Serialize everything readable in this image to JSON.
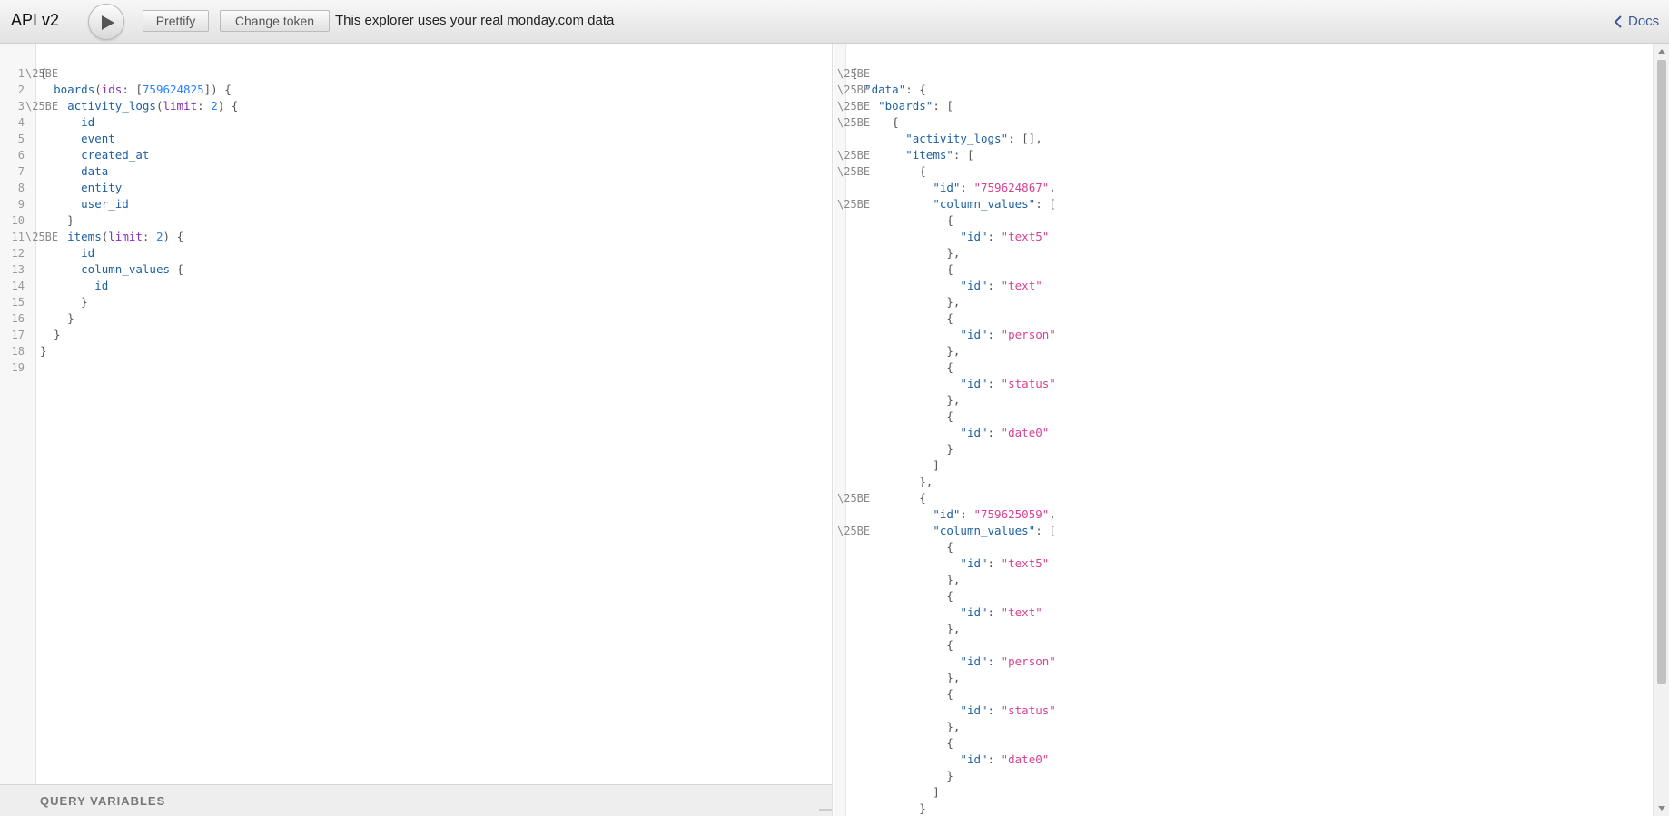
{
  "header": {
    "title": "API v2",
    "run_icon": "play-icon",
    "prettify_label": "Prettify",
    "change_token_label": "Change token",
    "notice": "This explorer uses your real monday.com data",
    "docs_label": "Docs",
    "docs_icon": "chevron-left-icon"
  },
  "editor": {
    "line_numbers": [
      "1",
      "2",
      "3",
      "4",
      "5",
      "6",
      "7",
      "8",
      "9",
      "10",
      "11",
      "12",
      "13",
      "14",
      "15",
      "16",
      "17",
      "18",
      "19"
    ],
    "fold_marker": "\\25BE",
    "lines": [
      "{",
      "  boards(ids: [759624825]) {",
      "    activity_logs(limit: 2) {",
      "      id",
      "      event",
      "      created_at",
      "      data",
      "      entity",
      "      user_id",
      "    }",
      "    items(limit: 2) {",
      "      id",
      "      column_values {",
      "        id",
      "      }",
      "    }",
      "  }",
      "}",
      ""
    ]
  },
  "query_variables": {
    "label": "QUERY VARIABLES"
  },
  "result": {
    "fold_marker": "\\25BE",
    "lines": [
      "{",
      "  \"data\": {",
      "    \"boards\": [",
      "      {",
      "        \"activity_logs\": [],",
      "        \"items\": [",
      "          {",
      "            \"id\": \"759624867\",",
      "            \"column_values\": [",
      "              {",
      "                \"id\": \"text5\"",
      "              },",
      "              {",
      "                \"id\": \"text\"",
      "              },",
      "              {",
      "                \"id\": \"person\"",
      "              },",
      "              {",
      "                \"id\": \"status\"",
      "              },",
      "              {",
      "                \"id\": \"date0\"",
      "              }",
      "            ]",
      "          },",
      "          {",
      "            \"id\": \"759625059\",",
      "            \"column_values\": [",
      "              {",
      "                \"id\": \"text5\"",
      "              },",
      "              {",
      "                \"id\": \"text\"",
      "              },",
      "              {",
      "                \"id\": \"person\"",
      "              },",
      "              {",
      "                \"id\": \"status\"",
      "              },",
      "              {",
      "                \"id\": \"date0\"",
      "              }",
      "            ]",
      "          }"
    ]
  },
  "colors": {
    "keyword": "#1f61a0",
    "argument": "#8b2bb9",
    "number": "#2882f9",
    "string": "#d64292",
    "link": "#3b5998"
  }
}
